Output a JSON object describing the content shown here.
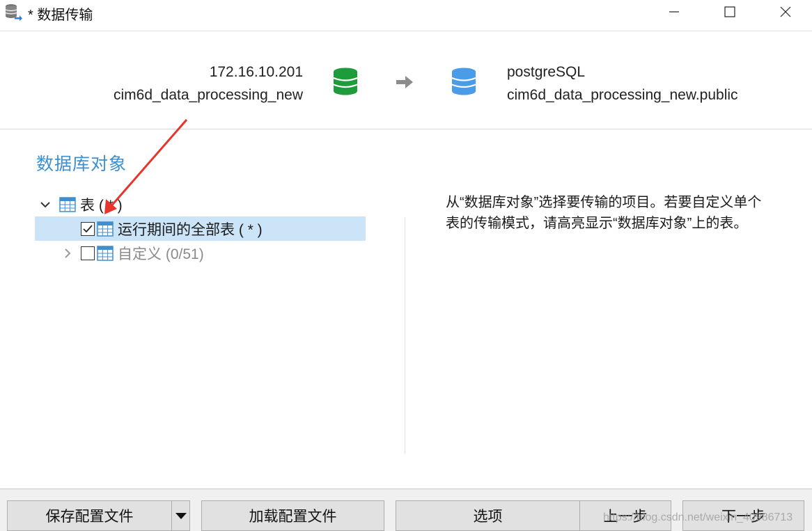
{
  "window": {
    "title": "* 数据传输",
    "icon": "database-transfer-icon",
    "controls": [
      "minimize-icon",
      "maximize-icon",
      "close-icon"
    ]
  },
  "source": {
    "host": "172.16.10.201",
    "database": "cim6d_data_processing_new",
    "icon": "database-icon",
    "color": "#1e9b3a"
  },
  "target": {
    "host": "postgreSQL",
    "database": "cim6d_data_processing_new.public",
    "icon": "database-icon",
    "color": "#4a9be8"
  },
  "transfer_arrow_icon": "arrow-right-icon",
  "objects_section": {
    "title": "数据库对象",
    "tree": {
      "root": {
        "label": "表 ( * )",
        "expanded": true
      },
      "children": [
        {
          "label": "运行期间的全部表 ( * )",
          "checked": true,
          "selected": true
        },
        {
          "label": "自定义 (0/51)",
          "checked": false,
          "selected": false
        }
      ]
    }
  },
  "description": "从“数据库对象”选择要传输的项目。若要自定义单个表的传输模式，请高亮显示“数据库对象”上的表。",
  "footer": {
    "save_config": "保存配置文件",
    "load_config": "加载配置文件",
    "options": "选项",
    "previous": "上一步",
    "next": "下一步",
    "watermark": "https://blog.csdn.net/weixin_40986713"
  },
  "accent_color": "#3d8fd0",
  "annotation_color": "#e8352b"
}
